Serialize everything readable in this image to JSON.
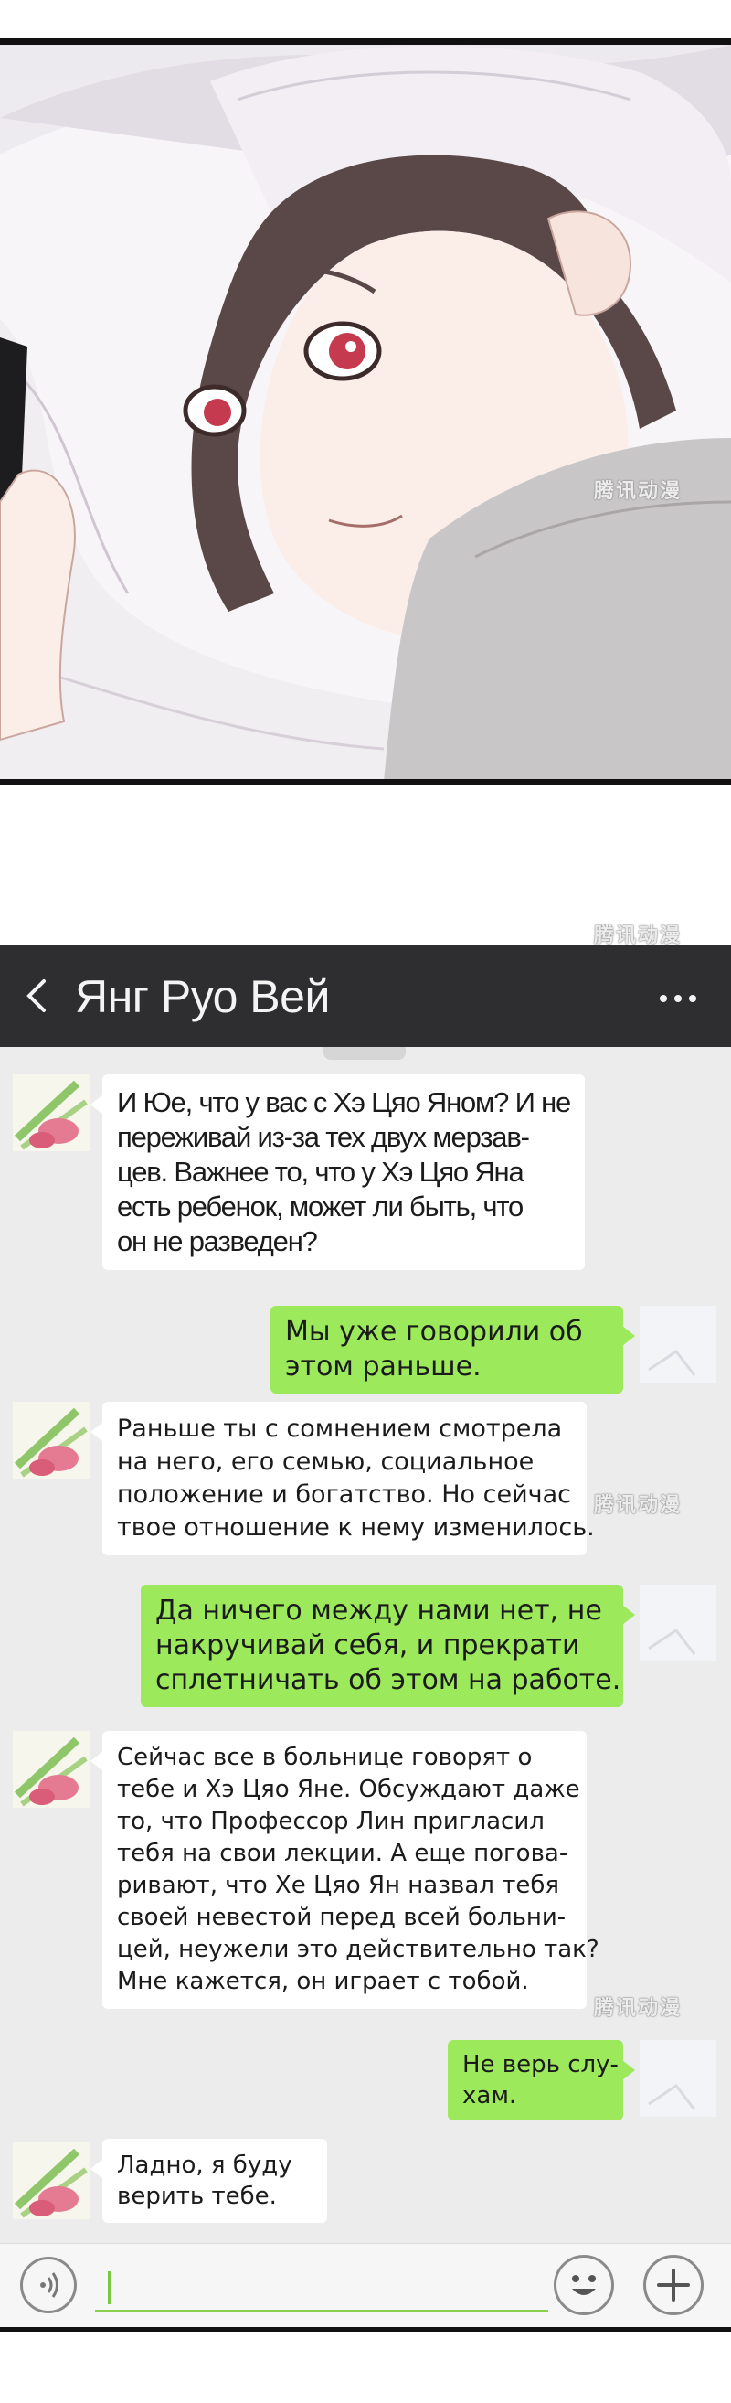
{
  "watermark": "腾讯动漫",
  "chat": {
    "title": "Янг Руо Вей",
    "messages": [
      {
        "side": "in",
        "lines": [
          "И Юе, что у вас с Хэ Цяо Яном? И не",
          "переживай из-за тех двух мерзав-",
          "цев. Важнее то, что у Хэ Цяо Яна",
          "есть ребенок, может ли быть, что",
          "он не разведен?"
        ]
      },
      {
        "side": "out",
        "lines": [
          "Мы уже говорили об",
          "этом раньше."
        ]
      },
      {
        "side": "in",
        "lines": [
          "Раньше ты с сомнением смотрела",
          "на него, его семью, социальное",
          "положение и богатство. Но сейчас",
          "твое отношение к нему изменилось."
        ]
      },
      {
        "side": "out",
        "lines": [
          "Да ничего между нами нет, не",
          "накручивай себя, и прекрати",
          "сплетничать об этом на работе."
        ]
      },
      {
        "side": "in",
        "lines": [
          "Сейчас все в больнице говорят о",
          "тебе и Хэ Цяо Яне. Обсуждают даже",
          "то, что Профессор Лин пригласил",
          "тебя на свои лекции. А еще погова-",
          "ривают, что Хе Цяо Ян назвал тебя",
          "своей невестой перед всей больни-",
          "цей, неужели это действительно так?",
          "Мне кажется, он играет с тобой."
        ]
      },
      {
        "side": "out",
        "lines": [
          "Не верь слу-",
          "хам."
        ]
      },
      {
        "side": "in",
        "lines": [
          "Ладно, я буду",
          "верить тебе."
        ]
      }
    ]
  },
  "input": {
    "value": "",
    "placeholder": ""
  },
  "icons": {
    "back": "chevron-left-icon",
    "more": "more-dots-icon",
    "voice": "voice-icon",
    "emoji": "emoji-icon",
    "plus": "plus-icon"
  },
  "colors": {
    "header": "#2e2e31",
    "outgoing": "#9de95c",
    "incoming": "#ffffff",
    "background": "#ececec"
  }
}
